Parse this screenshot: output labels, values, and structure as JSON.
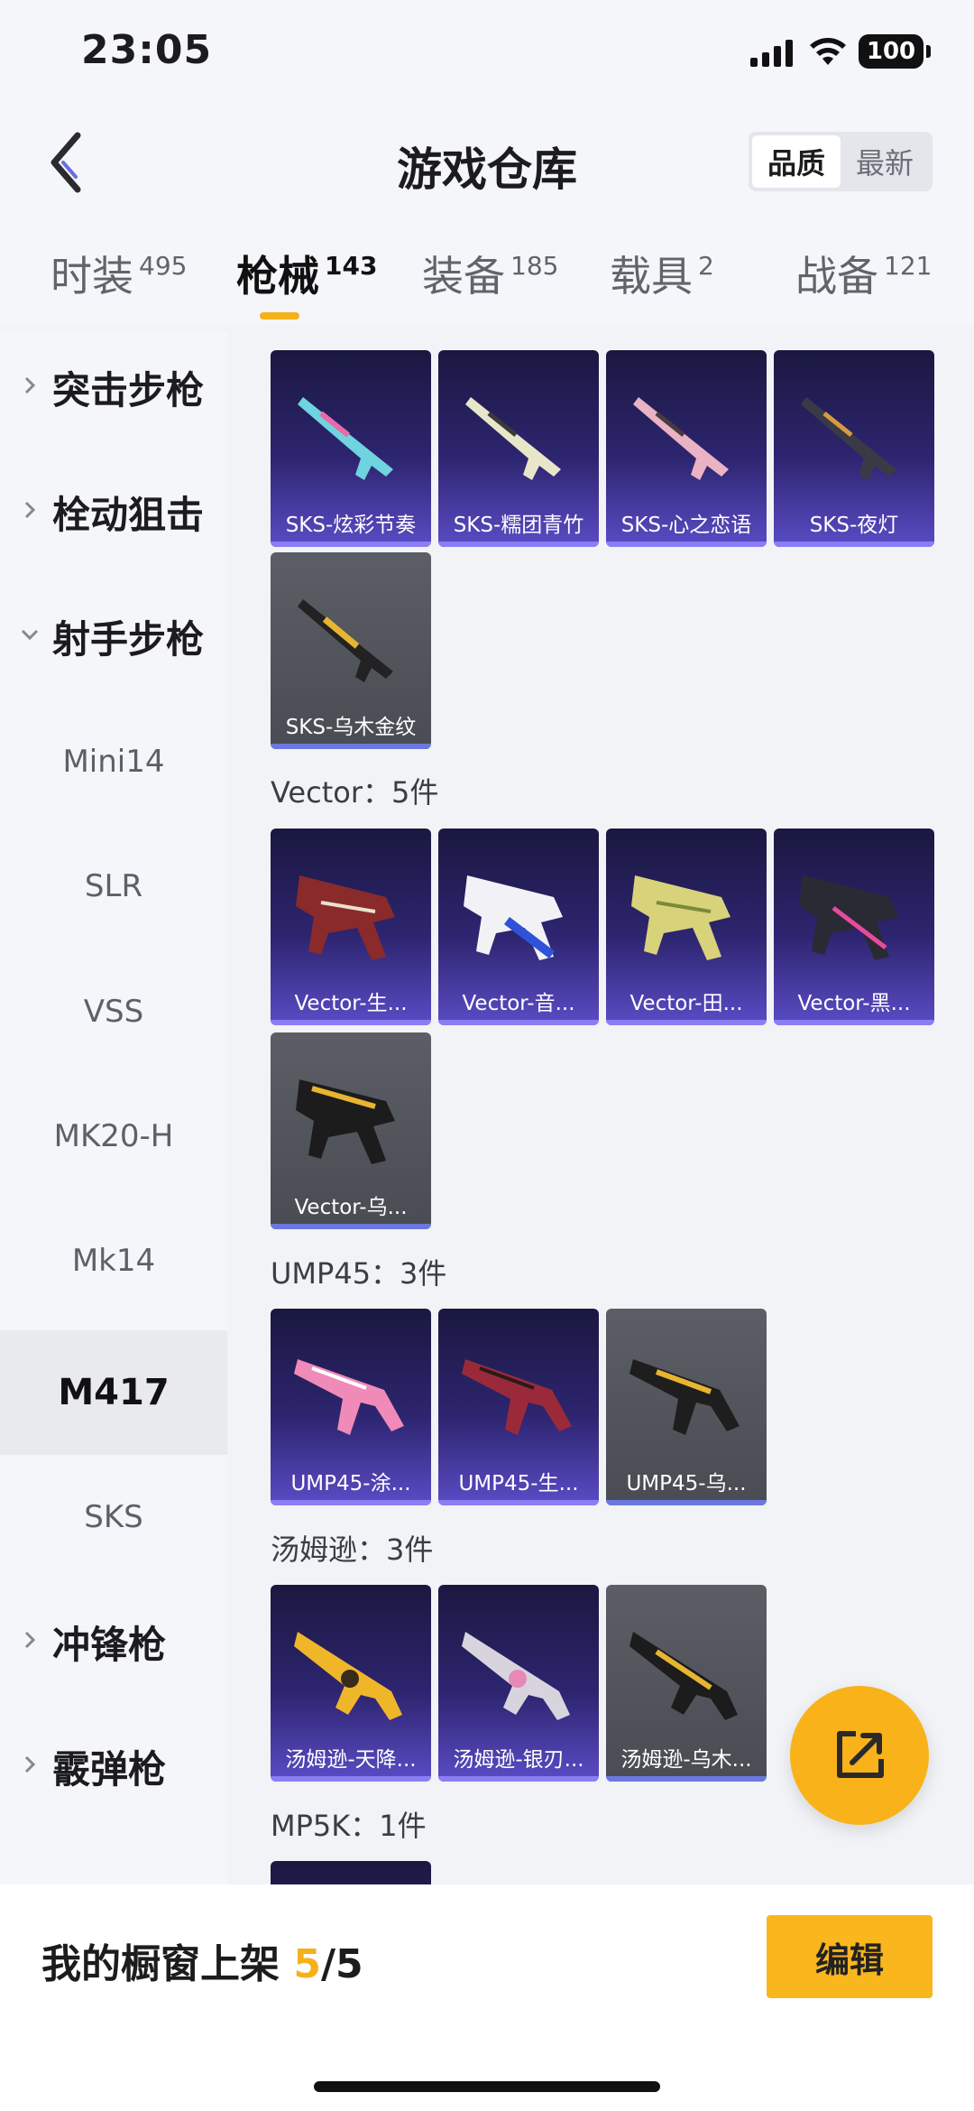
{
  "status_bar": {
    "time": "23:05",
    "battery": "100"
  },
  "header": {
    "title": "游戏仓库",
    "sort": {
      "quality": "品质",
      "newest": "最新"
    }
  },
  "tabs": [
    {
      "label": "时装",
      "count": "495"
    },
    {
      "label": "枪械",
      "count": "143"
    },
    {
      "label": "装备",
      "count": "185"
    },
    {
      "label": "载具",
      "count": "2"
    },
    {
      "label": "战备",
      "count": "121"
    }
  ],
  "sidebar": [
    {
      "label": "突击步枪"
    },
    {
      "label": "栓动狙击"
    },
    {
      "label": "射手步枪"
    },
    {
      "label": "Mini14"
    },
    {
      "label": "SLR"
    },
    {
      "label": "VSS"
    },
    {
      "label": "MK20-H"
    },
    {
      "label": "Mk14"
    },
    {
      "label": "M417"
    },
    {
      "label": "SKS"
    },
    {
      "label": "冲锋枪"
    },
    {
      "label": "霰弹枪"
    }
  ],
  "sections": {
    "sks": {
      "items": [
        "SKS-炫彩节奏",
        "SKS-糯团青竹",
        "SKS-心之恋语",
        "SKS-夜灯",
        "SKS-乌木金纹"
      ]
    },
    "vector": {
      "title": "Vector：5件",
      "items": [
        "Vector-生...",
        "Vector-音...",
        "Vector-田...",
        "Vector-黑...",
        "Vector-乌..."
      ]
    },
    "ump45": {
      "title": "UMP45：3件",
      "items": [
        "UMP45-涂...",
        "UMP45-生...",
        "UMP45-乌..."
      ]
    },
    "thompson": {
      "title": "汤姆逊：3件",
      "items": [
        "汤姆逊-天降...",
        "汤姆逊-银刃...",
        "汤姆逊-乌木..."
      ]
    },
    "mp5k": {
      "title": "MP5K：1件"
    }
  },
  "bottom": {
    "showcase_label": "我的橱窗上架 ",
    "showcase_count": "5",
    "showcase_total": "/5",
    "edit_label": "编辑"
  },
  "colors": {
    "accent": "#f9b61d",
    "card_purple": "#3a2f8a",
    "card_grey": "#55575e"
  }
}
